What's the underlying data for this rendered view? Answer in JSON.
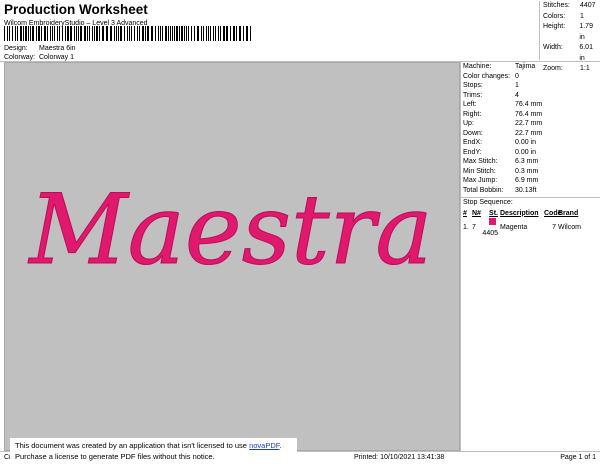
{
  "header": {
    "title": "Production Worksheet",
    "subtitle": "Wilcom EmbroideryStudio – Level 3 Advanced",
    "design_label": "Design:",
    "design_value": "Maestra 6in",
    "colorway_label": "Colorway:",
    "colorway_value": "Colorway 1"
  },
  "summary": [
    {
      "label": "Stitches:",
      "value": "4407"
    },
    {
      "label": "Colors:",
      "value": "1"
    },
    {
      "label": "Height:",
      "value": "1.79 in"
    },
    {
      "label": "Width:",
      "value": "6.01 in"
    },
    {
      "label": "Zoom:",
      "value": "1:1"
    }
  ],
  "design": {
    "text": "Maestra",
    "thread_color": "#e0186e",
    "background": "#c0c0c0"
  },
  "machine_info": [
    {
      "label": "Machine:",
      "value": "Tajima"
    },
    {
      "label": "Color changes:",
      "value": "0"
    },
    {
      "label": "Stops:",
      "value": "1"
    },
    {
      "label": "Trims:",
      "value": "4"
    },
    {
      "label": "Left:",
      "value": "76.4 mm"
    },
    {
      "label": "Right:",
      "value": "76.4 mm"
    },
    {
      "label": "Up:",
      "value": "22.7 mm"
    },
    {
      "label": "Down:",
      "value": "22.7 mm"
    },
    {
      "label": "EndX:",
      "value": "0.00 in"
    },
    {
      "label": "EndY:",
      "value": "0.00 in"
    },
    {
      "label": "Max Stitch:",
      "value": "6.3 mm"
    },
    {
      "label": "Min Stitch:",
      "value": "0.3 mm"
    },
    {
      "label": "Max Jump:",
      "value": "6.9 mm"
    },
    {
      "label": "Total Bobbin:",
      "value": "30.13ft"
    }
  ],
  "stop_sequence": {
    "title": "Stop Sequence:",
    "headers": [
      "#",
      "N#",
      "St.",
      "Description",
      "Code",
      "Brand"
    ],
    "rows": [
      {
        "num": "1.",
        "n": "7",
        "st": "4405",
        "description": "Magenta",
        "code": "7",
        "brand": "Wilcom",
        "color": "#e0186e"
      }
    ]
  },
  "footer": {
    "left": "Cr",
    "printed": "Printed: 10/10/2021 13:41:38",
    "page": "Page 1 of 1"
  },
  "notice": {
    "line1_prefix": "This document was created by an application that isn't licensed to use ",
    "link": "novaPDF",
    "line1_suffix": ".",
    "line2": "Purchase a license to generate PDF files without this notice."
  }
}
